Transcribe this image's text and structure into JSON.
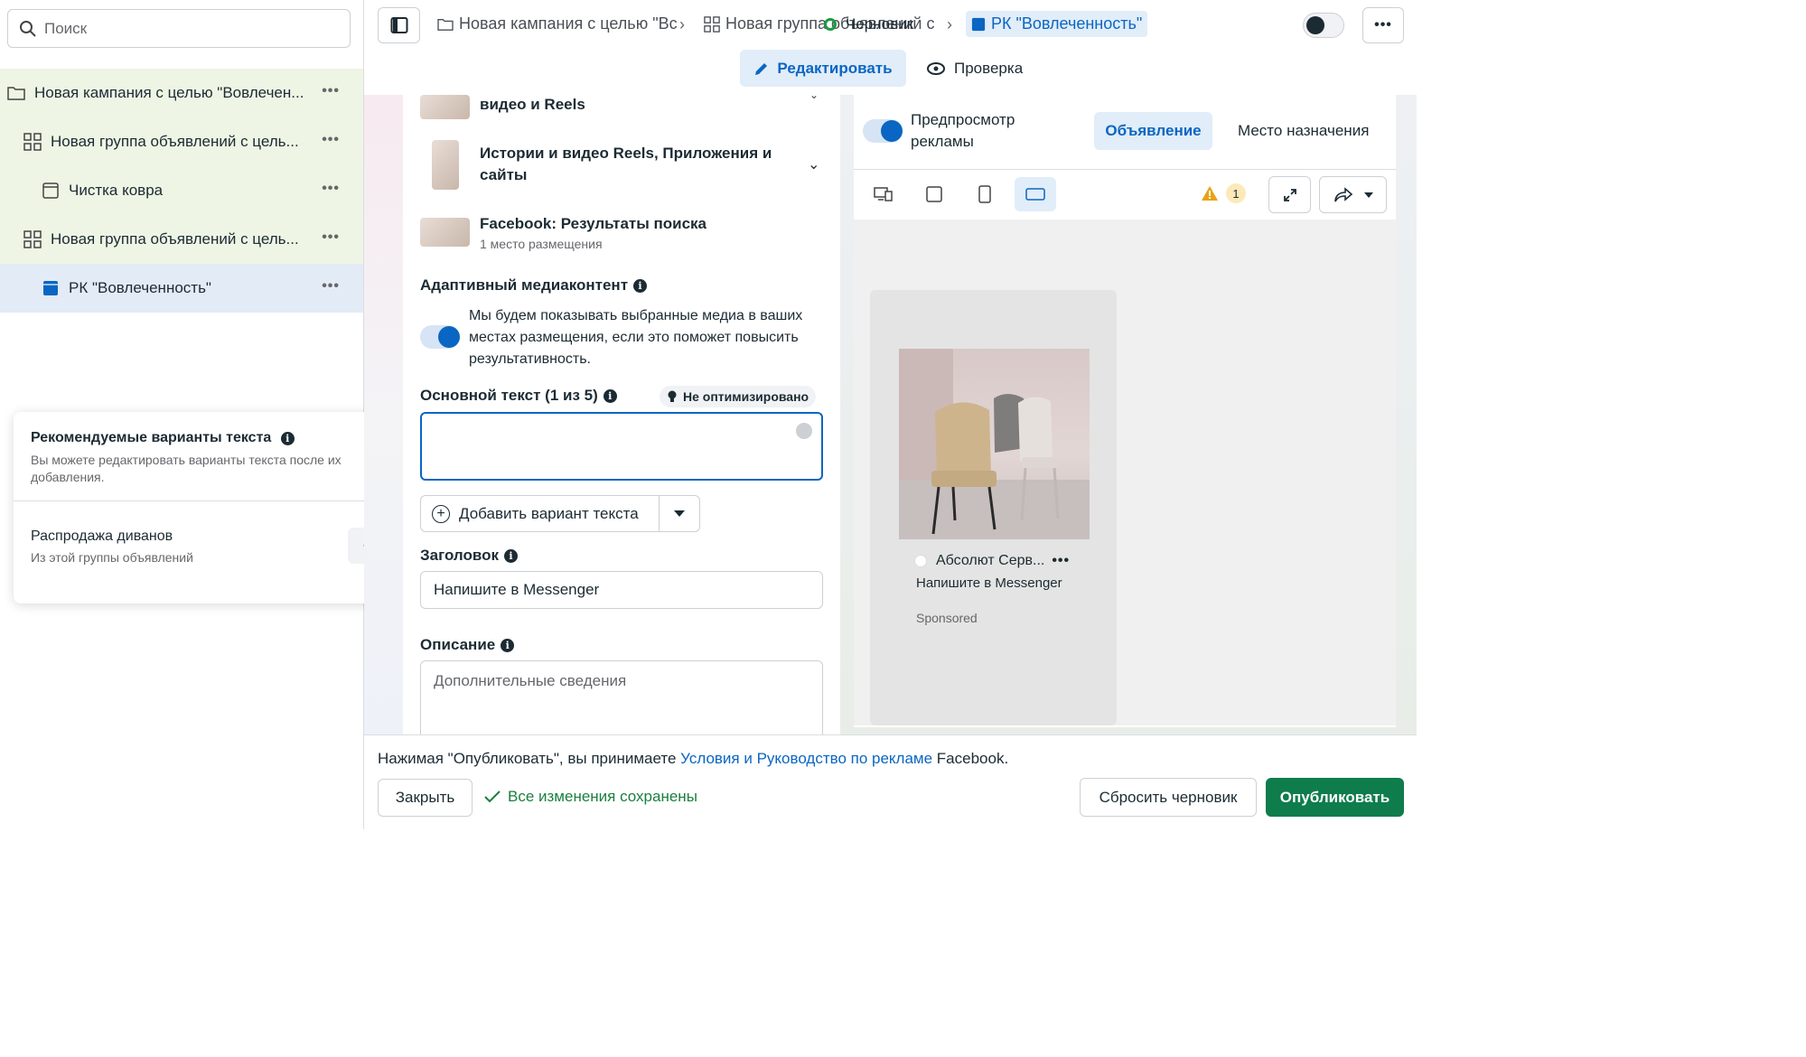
{
  "colors": {
    "accent": "#0a66c2",
    "publish": "#0f7c4c",
    "saved": "#1a7f3e",
    "tree_bg": "#eef5e4",
    "selected_bg": "#e3ebf6"
  },
  "sidebar": {
    "search_placeholder": "Поиск",
    "tree": [
      {
        "label": "Новая кампания с целью \"Вовлечен...",
        "icon": "folder-icon"
      },
      {
        "label": "Новая группа объявлений с цель...",
        "icon": "grid-icon"
      },
      {
        "label": "Чистка ковра",
        "icon": "ad-icon"
      },
      {
        "label": "Новая группа объявлений с цель...",
        "icon": "grid-icon"
      },
      {
        "label": "РК \"Вовлеченность\"",
        "icon": "ad-filled-icon",
        "selected": true
      }
    ],
    "recommend": {
      "title": "Рекомендуемые варианты текста",
      "subtitle": "Вы можете редактировать варианты текста после их добавления.",
      "suggestion_title": "Распродажа диванов",
      "suggestion_source": "Из этой группы объявлений"
    }
  },
  "topbar": {
    "crumb1": "Новая кампания с целью \"Вс",
    "crumb2": "Новая группа объявлений с",
    "crumb3": "РК \"Вовлеченность\"",
    "status": "Черновик",
    "edit": "Редактировать",
    "review": "Проверка"
  },
  "editor": {
    "placement_partial": "видео и Reels",
    "placement2": "Истории и видео Reels, Приложения и сайты",
    "placement3": "Facebook: Результаты поиска",
    "placement3_sub": "1 место размещения",
    "adaptive_label": "Адаптивный медиаконтент",
    "adaptive_text": "Мы будем показывать выбранные медиа в ваших местах размещения, если это поможет повысить результативность.",
    "primary_label": "Основной текст (1 из 5)",
    "not_optimized": "Не оптимизировано",
    "primary_value": "",
    "add_variant": "Добавить вариант текста",
    "headline_label": "Заголовок",
    "headline_value": "Напишите в Messenger",
    "description_label": "Описание",
    "description_placeholder": "Дополнительные сведения"
  },
  "preview": {
    "toggle_label": "Предпросмотр рекламы",
    "tab_ad": "Объявление",
    "tab_dest": "Место назначения",
    "warning_count": "1",
    "page_name": "Абсолют Серв...",
    "cta": "Напишите в Messenger",
    "sponsored": "Sponsored"
  },
  "footer": {
    "terms_prefix": "Нажимая \"Опубликовать\", вы принимаете ",
    "terms_link": "Условия и Руководство по рекламе",
    "terms_suffix": " Facebook.",
    "close": "Закрыть",
    "saved": "Все изменения сохранены",
    "reset": "Сбросить черновик",
    "publish": "Опубликовать"
  }
}
